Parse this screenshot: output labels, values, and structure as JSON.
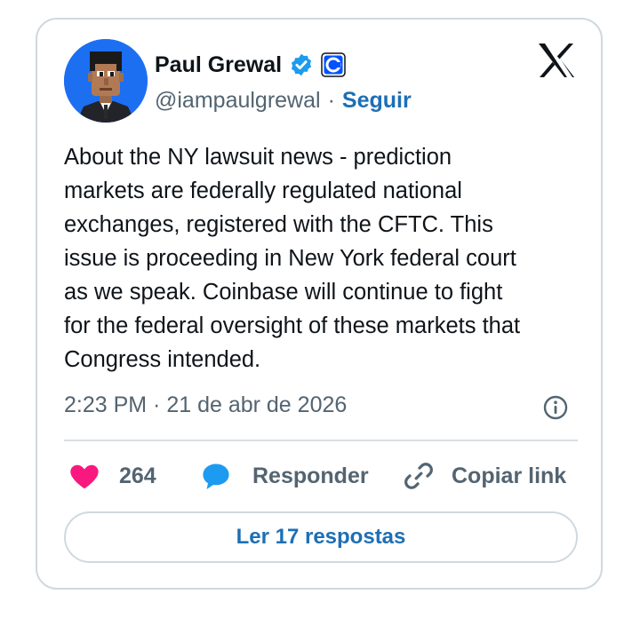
{
  "author": {
    "display_name": "Paul Grewal",
    "handle": "@iampaulgrewal",
    "separator": "·",
    "follow_label": "Seguir",
    "verified_icon": "verified-badge-icon",
    "affiliate_icon": "coinbase-affiliate-icon",
    "avatar_icon": "pixel-art-avatar"
  },
  "brand": {
    "logo_icon": "x-logo-icon",
    "accent_color": "#1d9bf0",
    "link_color": "#1d6fb5"
  },
  "tweet": {
    "text": "About the NY lawsuit news - prediction\nmarkets are federally regulated national\nexchanges, registered with the CFTC. This\nissue is proceeding in New York federal court\nas we speak. Coinbase will continue to fight\nfor the federal oversight of these markets that\nCongress intended.",
    "timestamp": "2:23 PM · 21 de abr de 2026",
    "info_icon": "info-circle-icon"
  },
  "actions": {
    "like": {
      "icon": "heart-icon",
      "count": "264",
      "color": "#f91880"
    },
    "reply": {
      "icon": "speech-bubble-icon",
      "label": "Responder",
      "color": "#1d9bf0"
    },
    "copy": {
      "icon": "link-icon",
      "label": "Copiar link"
    }
  },
  "read_replies_label": "Ler 17 respostas"
}
